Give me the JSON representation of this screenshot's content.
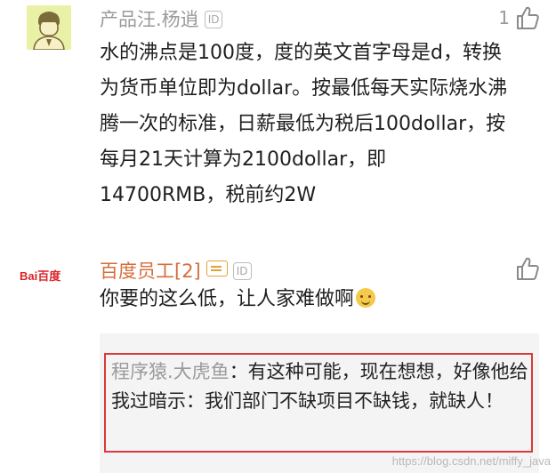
{
  "comments": [
    {
      "username": "产品汪.杨逍",
      "id_badge": "ID",
      "like_count": "1",
      "text": "水的沸点是100度，度的英文首字母是d，转换为货币单位即为dollar。按最低每天实际烧水沸腾一次的标准，日薪最低为税后100dollar，按每月21天计算为2100dollar，即14700RMB，税前约2W"
    },
    {
      "avatar_logo_text": "Bai百度",
      "username": "百度员工[2]",
      "id_badge": "ID",
      "text": "你要的这么低，让人家难做啊",
      "reply": {
        "author": "程序猿.大虎鱼",
        "text": "：有这种可能，现在想想，好像他给我过暗示：我们部门不缺项目不缺钱，就缺人！"
      }
    }
  ],
  "watermark": "https://blog.csdn.net/miffy_java"
}
